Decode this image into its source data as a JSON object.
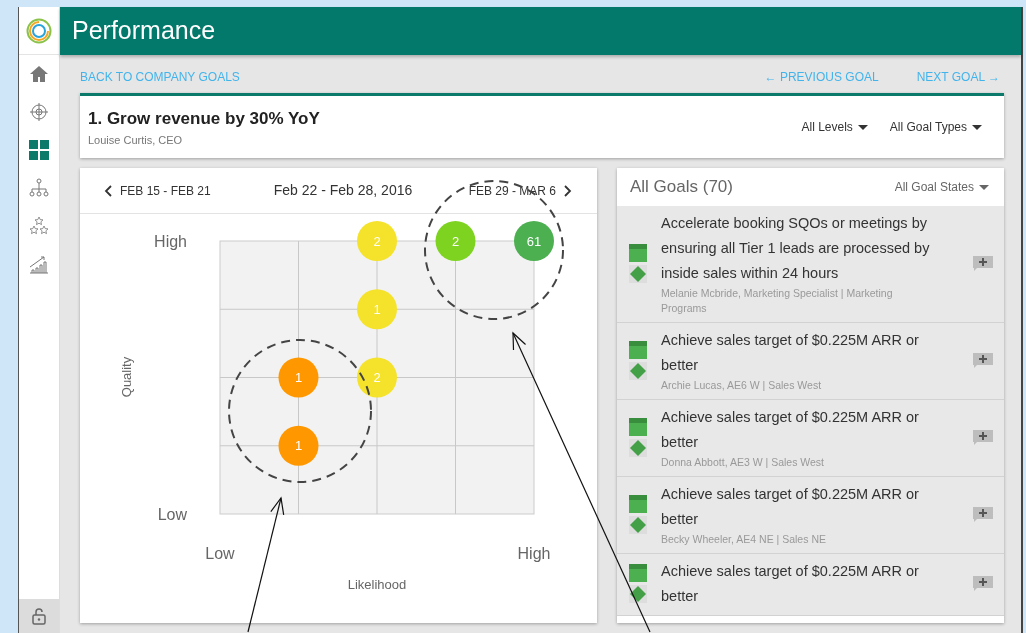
{
  "header": {
    "title": "Performance"
  },
  "sidebar": {
    "items": [
      {
        "kind": "home",
        "selected": false
      },
      {
        "kind": "target",
        "selected": false
      },
      {
        "kind": "grid",
        "selected": true
      },
      {
        "kind": "tree",
        "selected": false
      },
      {
        "kind": "stars",
        "selected": false
      },
      {
        "kind": "growth",
        "selected": false
      }
    ],
    "footer": {
      "kind": "lock"
    }
  },
  "nav": {
    "back": "BACK TO COMPANY GOALS",
    "previous": "← PREVIOUS GOAL",
    "next": "NEXT GOAL →"
  },
  "goal": {
    "title": "1. Grow revenue by 30% YoY",
    "owner": "Louise Curtis, CEO",
    "filters": [
      "All Levels",
      "All Goal Types"
    ]
  },
  "chart_panel": {
    "prev_week": "FEB 15 - FEB 21",
    "current_week": "Feb 22 - Feb 28, 2016",
    "next_week": "FEB 29 - MAR 6",
    "matrix": {
      "x_axis": {
        "title": "Likelihood",
        "low": "Low",
        "high": "High"
      },
      "y_axis": {
        "title": "Quality",
        "low": "Low",
        "high": "High"
      },
      "rows": [
        [
          null,
          null,
          {
            "count": "2",
            "color": "#f5e22b"
          },
          {
            "count": "2",
            "color": "#7ed321"
          },
          {
            "count": "61",
            "color": "#4caf50"
          }
        ],
        [
          null,
          null,
          {
            "count": "1",
            "color": "#f5e22b"
          },
          null,
          null
        ],
        [
          null,
          {
            "count": "1",
            "color": "#ff9800"
          },
          {
            "count": "2",
            "color": "#f5e22b"
          },
          null,
          null
        ],
        [
          null,
          {
            "count": "1",
            "color": "#ff9800"
          },
          null,
          null,
          null
        ],
        [
          null,
          null,
          null,
          null,
          null
        ]
      ]
    }
  },
  "goals_panel": {
    "title": "All Goals (70)",
    "filter": "All Goal States",
    "goals": [
      {
        "title": "Accelerate booking SQOs or meetings by ensuring all Tier 1 leads are processed by inside sales within 24 hours",
        "owner": "Melanie Mcbride, Marketing Specialist | Marketing Programs"
      },
      {
        "title": "Achieve sales target of $0.225M ARR or better",
        "owner": "Archie Lucas, AE6 W | Sales West"
      },
      {
        "title": "Achieve sales target of $0.225M ARR or better",
        "owner": "Donna Abbott, AE3 W | Sales West"
      },
      {
        "title": "Achieve sales target of $0.225M ARR or better",
        "owner": "Becky Wheeler, AE4 NE | Sales NE"
      },
      {
        "title": "Achieve sales target of $0.225M ARR or better"
      }
    ]
  }
}
